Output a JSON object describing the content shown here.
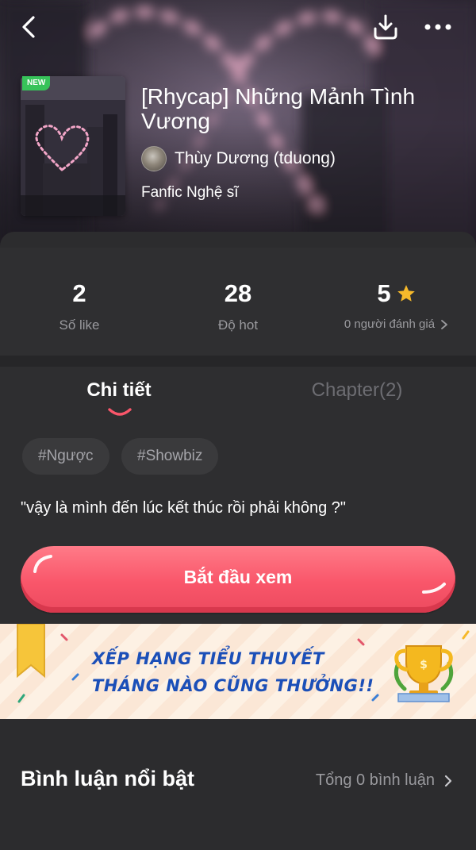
{
  "story": {
    "badge": "NEW",
    "title": "[Rhycap] Những Mảnh Tình Vương",
    "author": "Thùy Dương (tduong)",
    "category": "Fanfic Nghệ sĩ"
  },
  "stats": {
    "likes": {
      "value": "2",
      "label": "Số like"
    },
    "hot": {
      "value": "28",
      "label": "Độ hot"
    },
    "rating": {
      "value": "5",
      "label": "0 người đánh giá"
    }
  },
  "tabs": {
    "detail": "Chi tiết",
    "chapter": "Chapter(2)"
  },
  "tags": [
    "#Ngược",
    "#Showbiz"
  ],
  "summary": "\"vậy là mình đến lúc kết thúc rồi phải không ?\"",
  "start_button": "Bắt đầu xem",
  "banner": {
    "line1": "XẾP HẠNG TIỂU THUYẾT",
    "line2": "THÁNG NÀO CŨNG THƯỞNG!!"
  },
  "comments": {
    "title": "Bình luận nổi bật",
    "total": "Tổng 0 bình luận"
  },
  "colors": {
    "accent": "#f9566a",
    "star": "#f6b92b",
    "background": "#2e2e30",
    "muted_text": "#9a9a9e"
  }
}
